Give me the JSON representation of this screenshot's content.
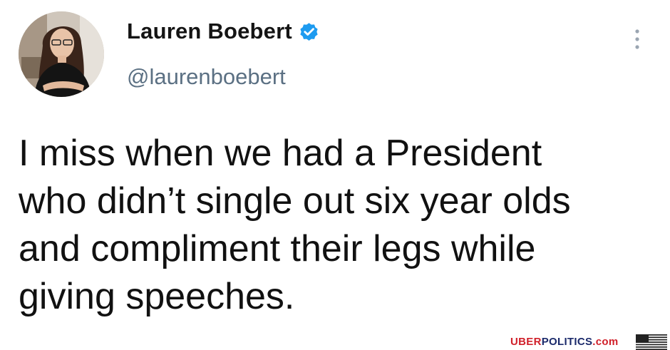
{
  "tweet": {
    "author_name": "Lauren Boebert",
    "handle": "@laurenboebert",
    "text": "I miss when we had a President\nwho didn’t single out six year olds\nand compliment their legs while\ngiving speeches.",
    "verified": true
  },
  "icons": {
    "verified": "verified-badge-icon",
    "more": "more-vertical-icon",
    "flag": "us-flag-icon"
  },
  "watermark": {
    "part1": "UBER",
    "part2": "POLITICS",
    "part3": ".com"
  },
  "colors": {
    "verified_blue": "#1d9bf0",
    "handle_gray": "#5b7083",
    "watermark_red": "#d0202a",
    "watermark_blue": "#1b2a6b"
  }
}
